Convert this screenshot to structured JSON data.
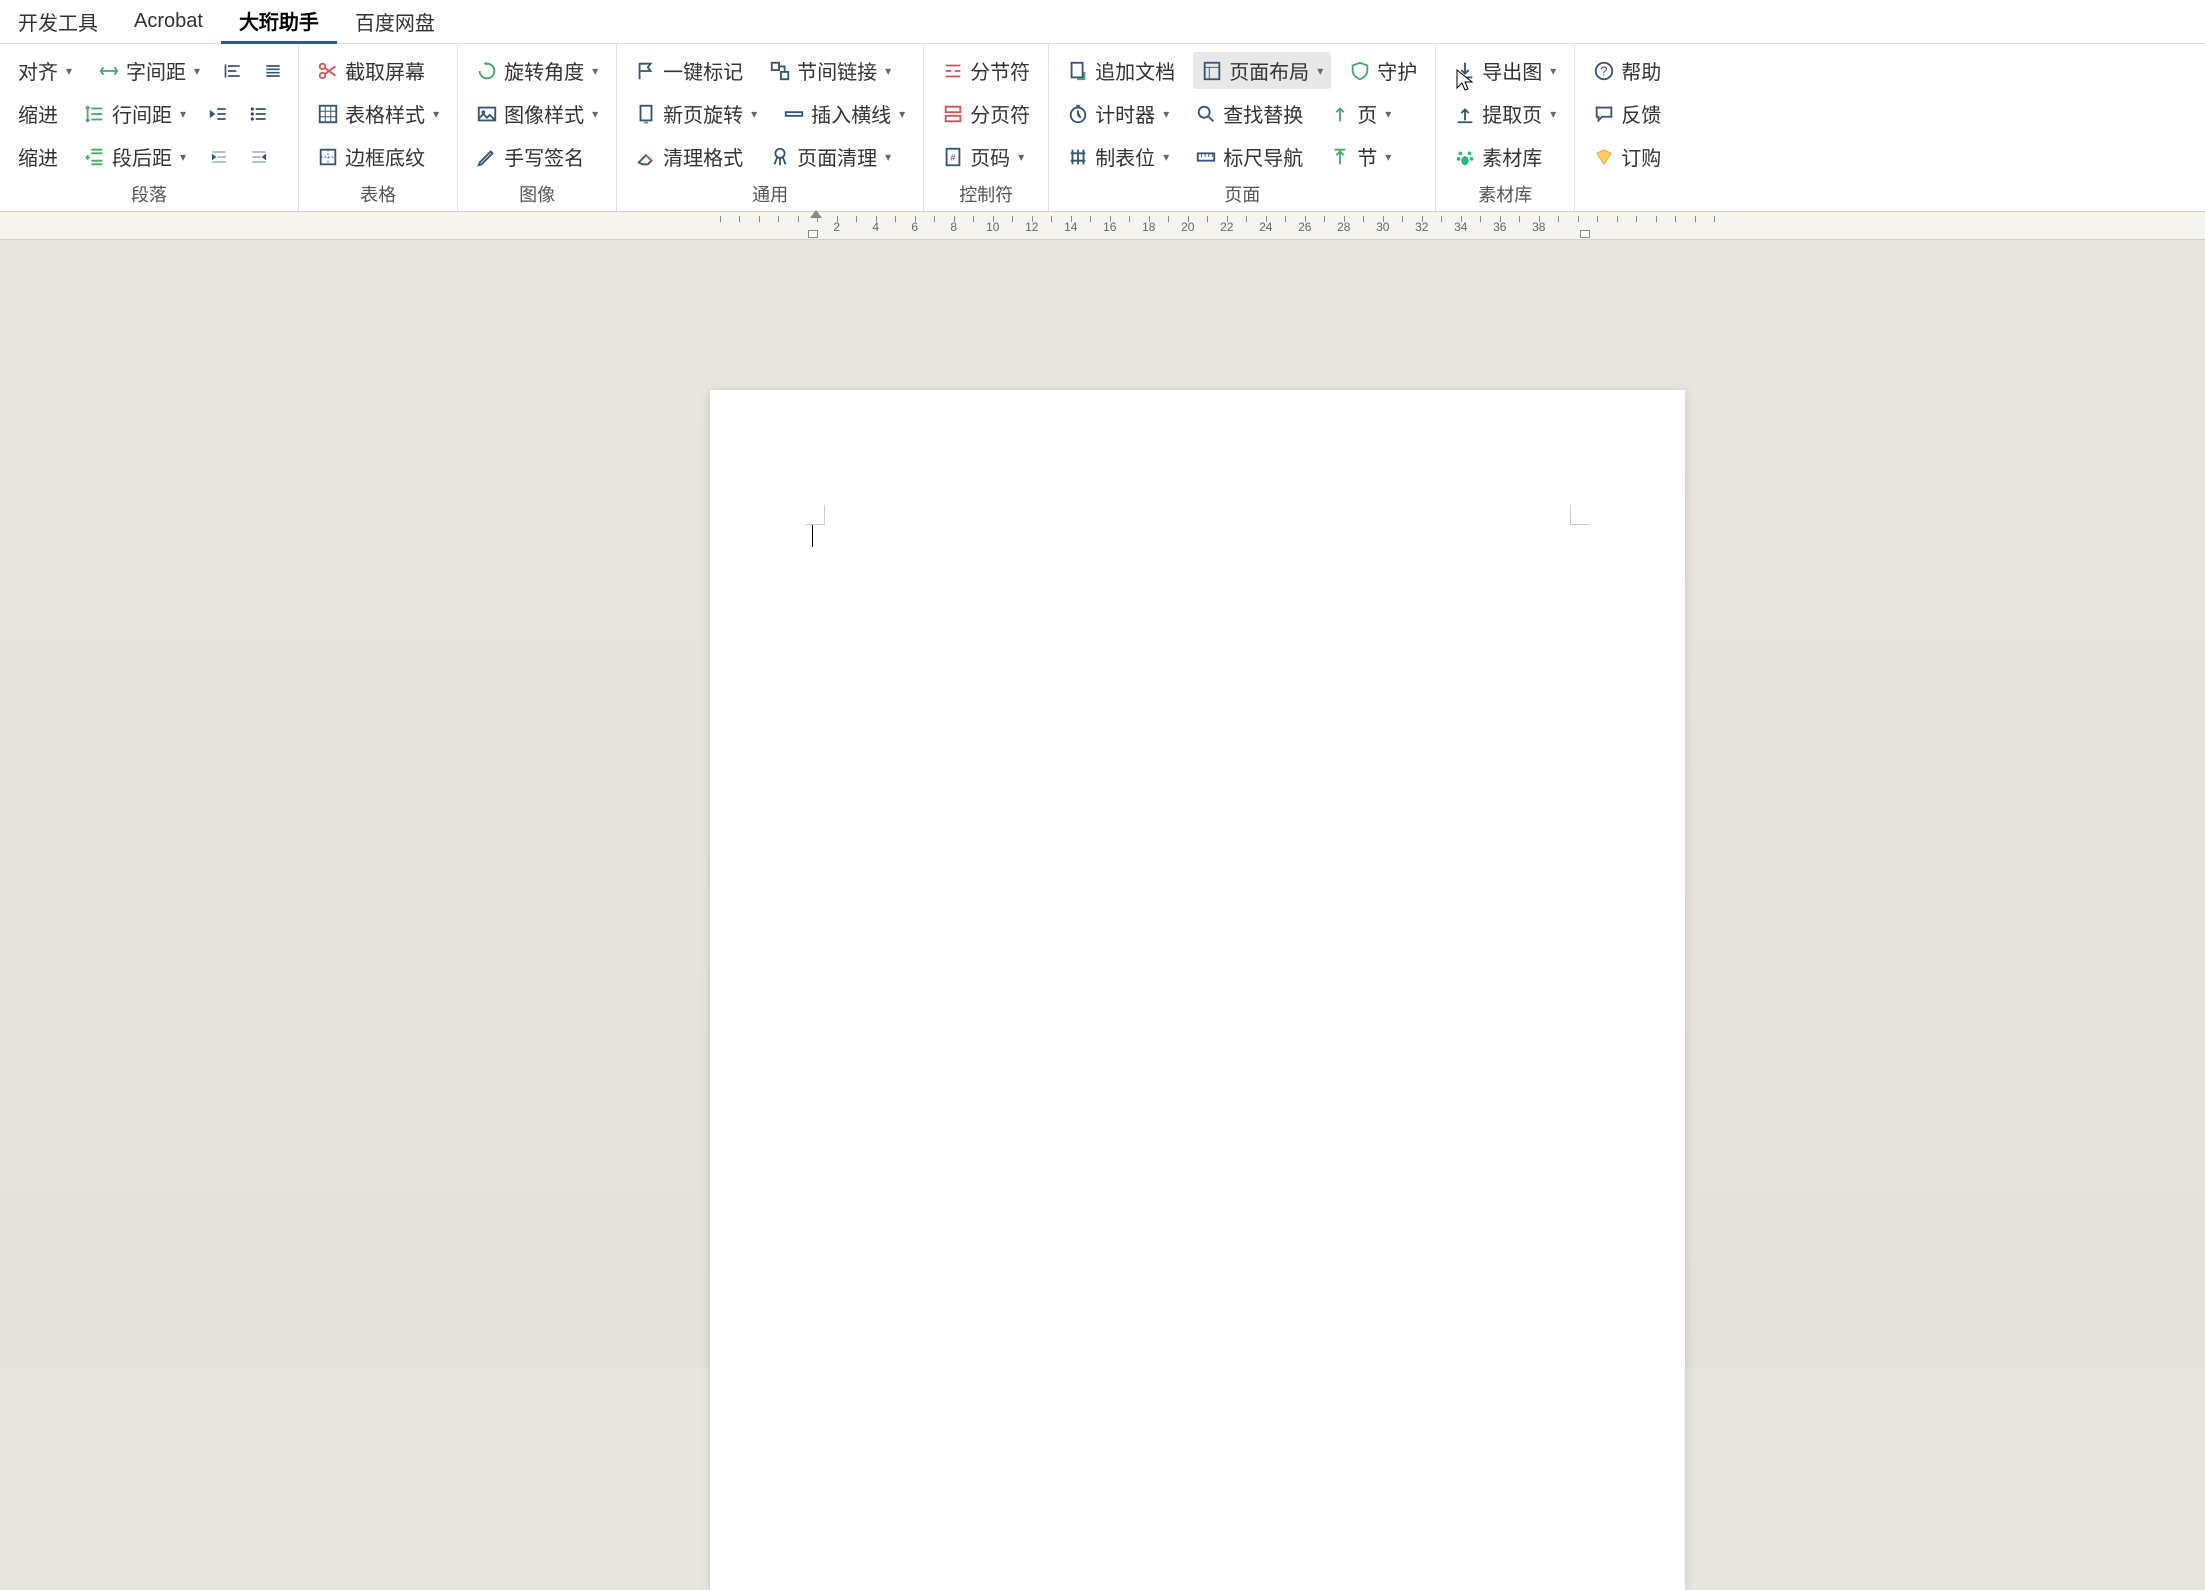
{
  "menubar": {
    "items": [
      {
        "label": "开发工具",
        "active": false
      },
      {
        "label": "Acrobat",
        "active": false
      },
      {
        "label": "大珩助手",
        "active": true
      },
      {
        "label": "百度网盘",
        "active": false
      }
    ]
  },
  "ribbon": {
    "groups": [
      {
        "name": "para",
        "label": "段落",
        "buttons": {
          "align": "对齐",
          "indent": "缩进",
          "charSpacing": "字间距",
          "lineSpacing": "行间距",
          "paraSpacing": "段后距"
        }
      },
      {
        "name": "table",
        "label": "表格",
        "buttons": {
          "screenshot": "截取屏幕",
          "tableStyle": "表格样式",
          "borderShading": "边框底纹"
        }
      },
      {
        "name": "image",
        "label": "图像",
        "buttons": {
          "rotateAngle": "旋转角度",
          "imageStyle": "图像样式",
          "handSign": "手写签名"
        }
      },
      {
        "name": "general",
        "label": "通用",
        "buttons": {
          "oneClickMark": "一键标记",
          "newPageRotate": "新页旋转",
          "clearFormat": "清理格式",
          "sectionLink": "节间链接",
          "insertHLine": "插入横线",
          "pageCleanup": "页面清理"
        }
      },
      {
        "name": "control",
        "label": "控制符",
        "buttons": {
          "sectionBreak": "分节符",
          "pageBreak": "分页符",
          "pageNumber": "页码"
        }
      },
      {
        "name": "page",
        "label": "页面",
        "buttons": {
          "appendDoc": "追加文档",
          "timer": "计时器",
          "tabStops": "制表位",
          "pageLayout": "页面布局",
          "findReplace": "查找替换",
          "rulerNav": "标尺导航",
          "protect": "守护",
          "page": "页",
          "section": "节"
        }
      },
      {
        "name": "resource",
        "label": "素材库",
        "buttons": {
          "exportImage": "导出图",
          "extractPage": "提取页",
          "resourceLib": "素材库"
        }
      },
      {
        "name": "help",
        "label": "",
        "buttons": {
          "help": "帮助",
          "feedback": "反馈",
          "subscribe": "订购"
        }
      }
    ]
  },
  "ruler": {
    "ticks": [
      2,
      4,
      6,
      8,
      10,
      12,
      14,
      16,
      18,
      20,
      22,
      24,
      26,
      28,
      30,
      32,
      34,
      36,
      38
    ]
  }
}
